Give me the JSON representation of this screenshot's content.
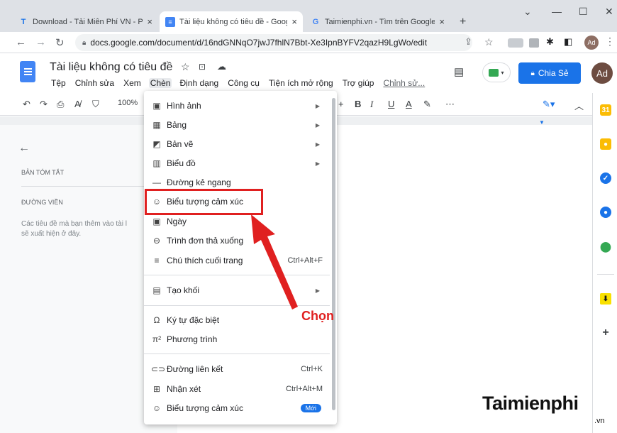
{
  "tabs": [
    {
      "title": "Download - Tải Miễn Phí VN - Ph",
      "close": "×",
      "color": "#1a73e8"
    },
    {
      "title": "Tài liệu không có tiêu đề - Googl",
      "close": "×",
      "color": "#4285f4"
    },
    {
      "title": "Taimienphi.vn - Tìm trên Google",
      "close": "×",
      "color": "#ea4335"
    }
  ],
  "new_tab": "+",
  "window": {
    "chevron": "⌄",
    "minimize": "—",
    "maximize": "☐",
    "close": "✕"
  },
  "address": {
    "url": "docs.google.com/document/d/16ndGNNqO7jwJ7fhlN7Bbt-Xe3IpnBYFV2qazH9LgWo/edit"
  },
  "browser_avatar": "Ad",
  "doc": {
    "title": "Tài liệu không có tiêu đề",
    "share": "Chia Sẻ",
    "avatar": "Ad"
  },
  "menus": [
    "Tệp",
    "Chỉnh sửa",
    "Xem",
    "Chèn",
    "Định dạng",
    "Công cụ",
    "Tiện ích mở rộng",
    "Trợ giúp",
    "Chỉnh sử..."
  ],
  "toolbar": {
    "zoom": "100%",
    "bold": "B",
    "italic": "I",
    "underline": "U",
    "color": "A",
    "more": "⋯"
  },
  "outline": {
    "summary_heading": "BẢN TÓM TẮT",
    "outline_heading": "ĐƯỜNG VIỀN",
    "hint": "Các tiêu đề mà bạn thêm vào tài l",
    "hint2": "sẽ xuất hiện ở đây."
  },
  "insert_menu": [
    {
      "label": "Hình ảnh",
      "icon": "image-icon",
      "submenu": true
    },
    {
      "label": "Bảng",
      "icon": "table-icon",
      "submenu": true
    },
    {
      "label": "Bản vẽ",
      "icon": "drawing-icon",
      "submenu": true
    },
    {
      "label": "Biểu đồ",
      "icon": "chart-icon",
      "submenu": true
    },
    {
      "label": "Đường kẻ ngang",
      "icon": "horizontal-line-icon"
    },
    {
      "label": "Biểu tượng cảm xúc",
      "icon": "emoji-icon"
    },
    {
      "label": "Ngày",
      "icon": "calendar-icon"
    },
    {
      "label": "Trình đơn thả xuống",
      "icon": "dropdown-icon"
    },
    {
      "label": "Chú thích cuối trang",
      "icon": "footnote-icon",
      "shortcut": "Ctrl+Alt+F"
    },
    {
      "label": "Tạo khối",
      "icon": "building-blocks-icon",
      "submenu": true
    },
    {
      "label": "Ký tự đặc biệt",
      "icon": "omega-icon"
    },
    {
      "label": "Phương trình",
      "icon": "equation-icon"
    },
    {
      "label": "Đường liên kết",
      "icon": "link-icon",
      "shortcut": "Ctrl+K"
    },
    {
      "label": "Nhận xét",
      "icon": "comment-icon",
      "shortcut": "Ctrl+Alt+M"
    },
    {
      "label": "Biểu tượng cảm xúc",
      "icon": "emoji-icon",
      "badge": "Mới"
    }
  ],
  "annotation": {
    "label": "Chọn",
    "color": "#e02020"
  },
  "watermark": {
    "logo": "Taimienphi",
    "suffix": ".vn"
  }
}
